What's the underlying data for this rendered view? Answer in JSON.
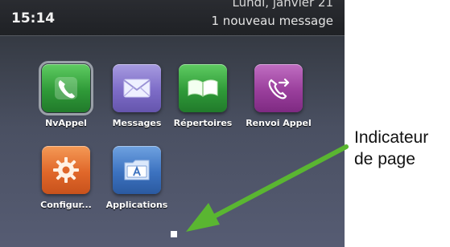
{
  "status_bar": {
    "time": "15:14",
    "date": "Lundi, janvier 21",
    "notification": "1 nouveau message"
  },
  "apps": [
    {
      "label": "NvAppel",
      "icon": "phone-icon",
      "color": "#2f9a38",
      "selected": true
    },
    {
      "label": "Messages",
      "icon": "envelope-icon",
      "color": "#7d6cc7"
    },
    {
      "label": "Répertoires",
      "icon": "open-book-icon",
      "color": "#2f9a38"
    },
    {
      "label": "Renvoi Appel",
      "icon": "call-forward-icon",
      "color": "#9a3f9c"
    },
    {
      "label": "Configur...",
      "icon": "gear-icon",
      "color": "#e0672a"
    },
    {
      "label": "Applications",
      "icon": "applications-folder-icon",
      "color": "#3c72c0"
    }
  ],
  "pagination": {
    "pages": 1,
    "current": 1
  },
  "annotation": {
    "line1": "Indicateur",
    "line2": "de page",
    "arrow_color": "#5ab631"
  }
}
